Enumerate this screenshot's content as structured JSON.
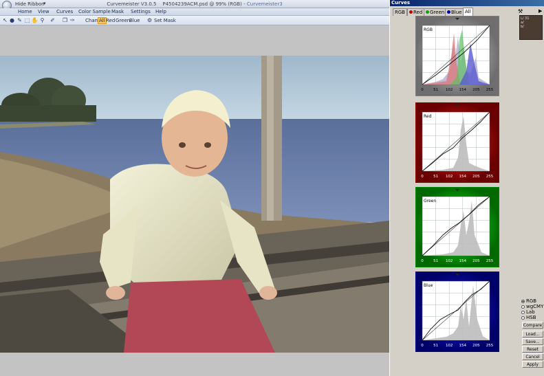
{
  "window": {
    "hide_ribbon": "Hide Ribbon",
    "qa_arrow": "▾",
    "title_app": "Curvemeister V3.0.5",
    "title_file": "P4504239ACM.psd @ 99% (RGB)",
    "title_sep": " - ",
    "title_sub": "Curvemeister3"
  },
  "menu": [
    "Home",
    "View",
    "Curves",
    "Color Sample",
    "Mask",
    "Settings",
    "Help"
  ],
  "toolbar": {
    "cham": "Cham",
    "all": "All",
    "red": "Red",
    "green": "Green",
    "blue": "Blue",
    "set_mask": "Set Mask"
  },
  "curves_panel": {
    "title": "Curves",
    "tabs": [
      "RGB",
      "Red",
      "Green",
      "Blue",
      "All"
    ],
    "graphs": [
      {
        "label": "RGB",
        "color": "#888888"
      },
      {
        "label": "Red",
        "color": "#cc0000"
      },
      {
        "label": "Green",
        "color": "#00aa00"
      },
      {
        "label": "Blue",
        "color": "#0000aa"
      }
    ],
    "x_ticks": [
      "0",
      "51",
      "102",
      "154",
      "205",
      "255"
    ],
    "preview": {
      "l": "L/ 31",
      "a": "a/",
      "b": "b/"
    },
    "color_modes": [
      "RGB",
      "wgCMYK",
      "Lab",
      "HSB"
    ],
    "selected_mode": "RGB",
    "buttons": [
      "Compare",
      "Load...",
      "Save...",
      "Reset",
      "Cancel",
      "Apply"
    ]
  }
}
